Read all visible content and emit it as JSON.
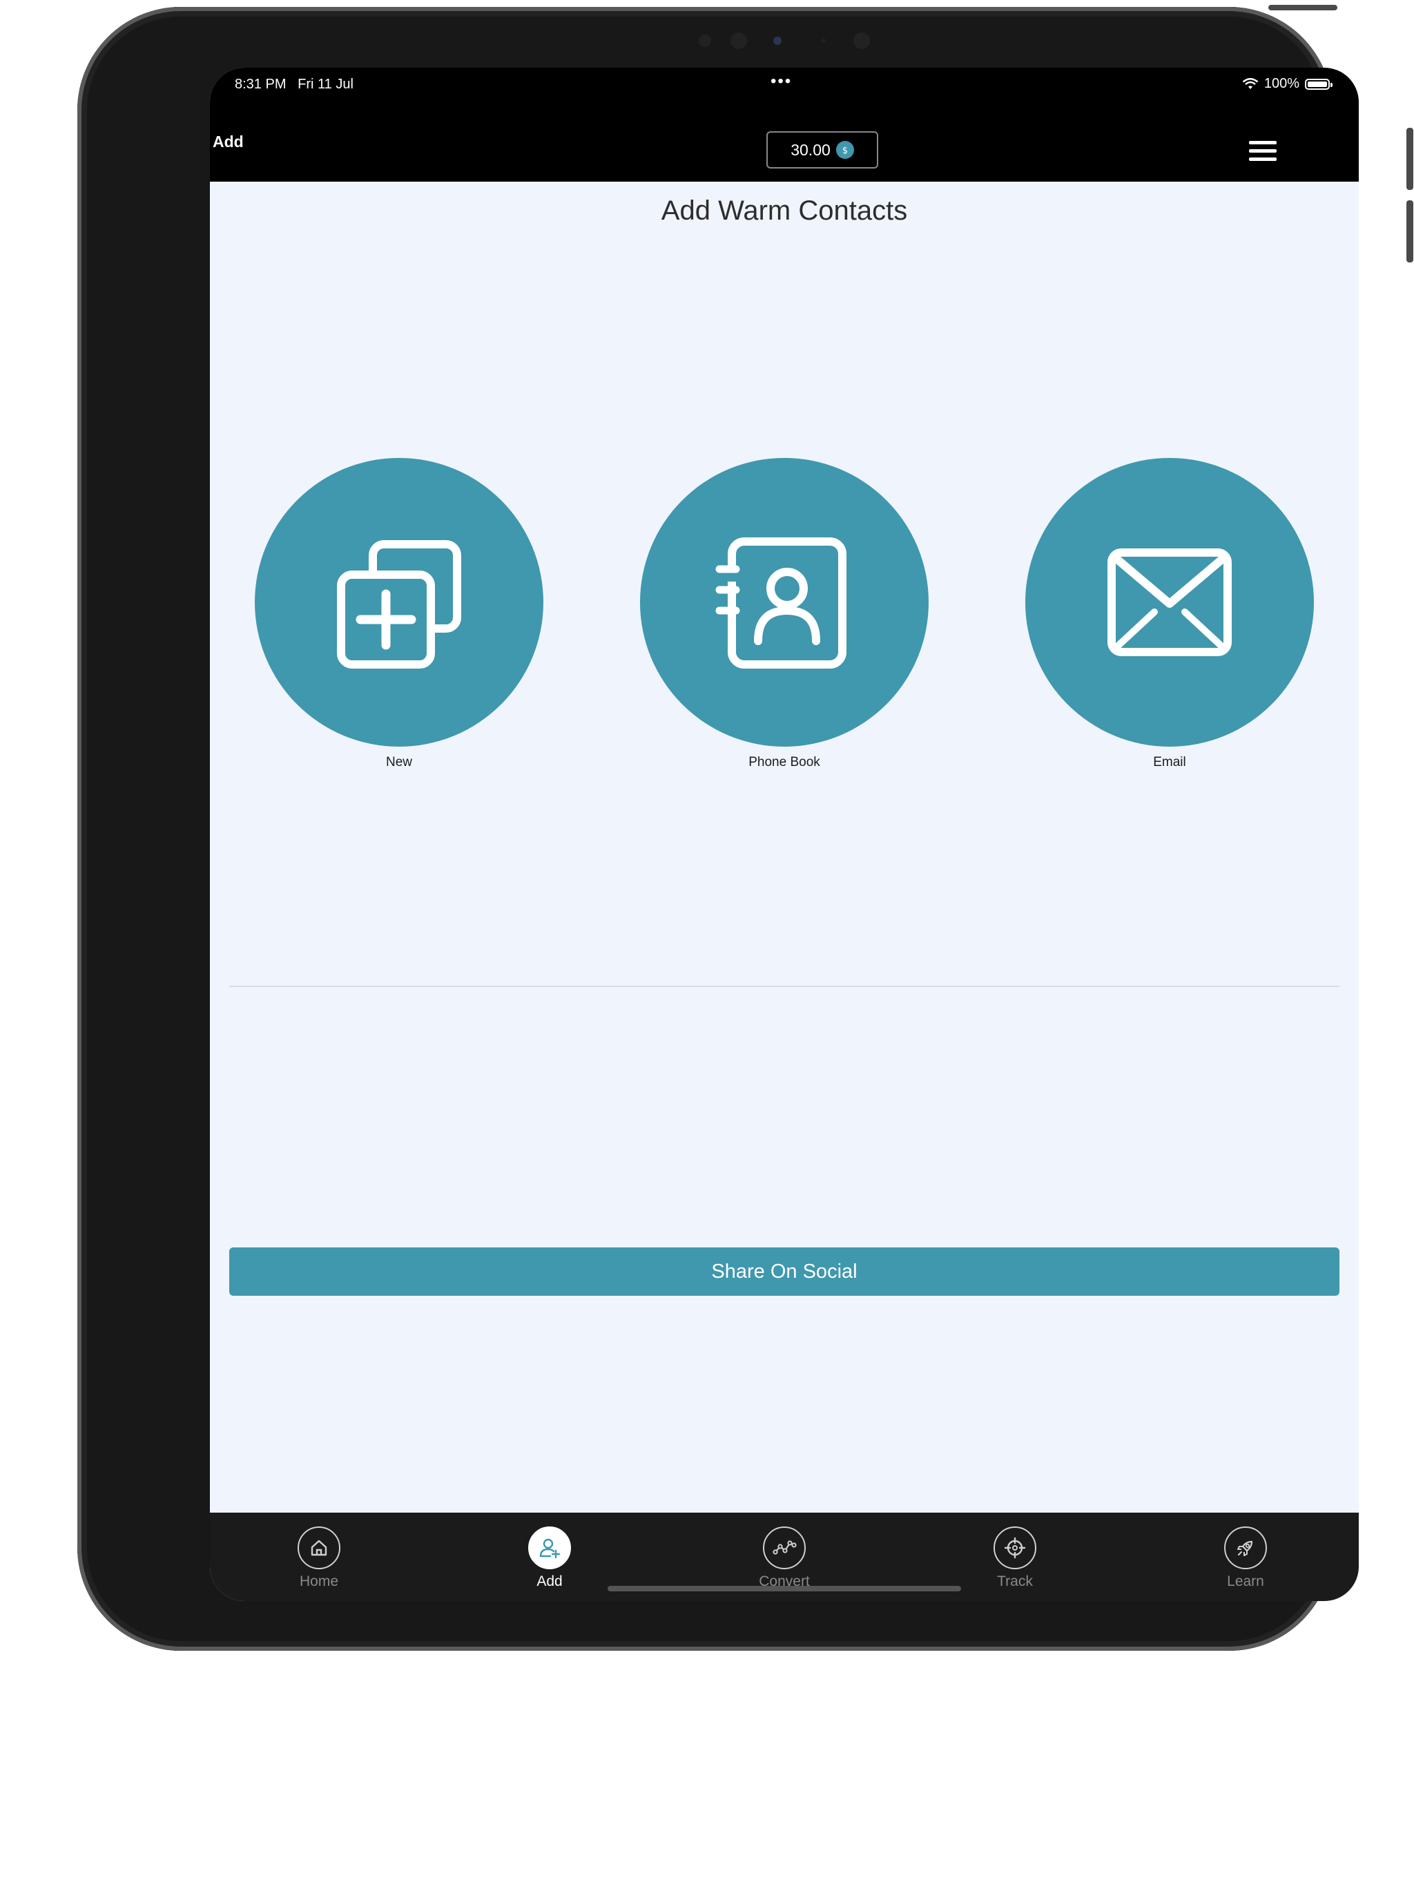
{
  "status": {
    "time": "8:31 PM",
    "date": "Fri 11 Jul",
    "battery": "100%"
  },
  "nav": {
    "left_label": "Add",
    "credits": "30.00"
  },
  "page": {
    "title": "Add Warm Contacts"
  },
  "actions": [
    {
      "label": "New"
    },
    {
      "label": "Phone Book"
    },
    {
      "label": "Email"
    }
  ],
  "share": {
    "label": "Share On Social"
  },
  "tabs": [
    {
      "label": "Home"
    },
    {
      "label": "Add"
    },
    {
      "label": "Convert"
    },
    {
      "label": "Track"
    },
    {
      "label": "Learn"
    }
  ],
  "colors": {
    "accent": "#3f98ad",
    "screen_bg": "#f0f4fc",
    "bars": "#000000",
    "tabbar": "#1b1b1b"
  },
  "icons": {
    "actions": [
      "add-duplicate-icon",
      "address-book-icon",
      "envelope-icon"
    ],
    "tabs": [
      "home-icon",
      "add-user-icon",
      "convert-chart-icon",
      "target-crosshair-icon",
      "rocket-icon"
    ]
  },
  "active_tab": "Add"
}
